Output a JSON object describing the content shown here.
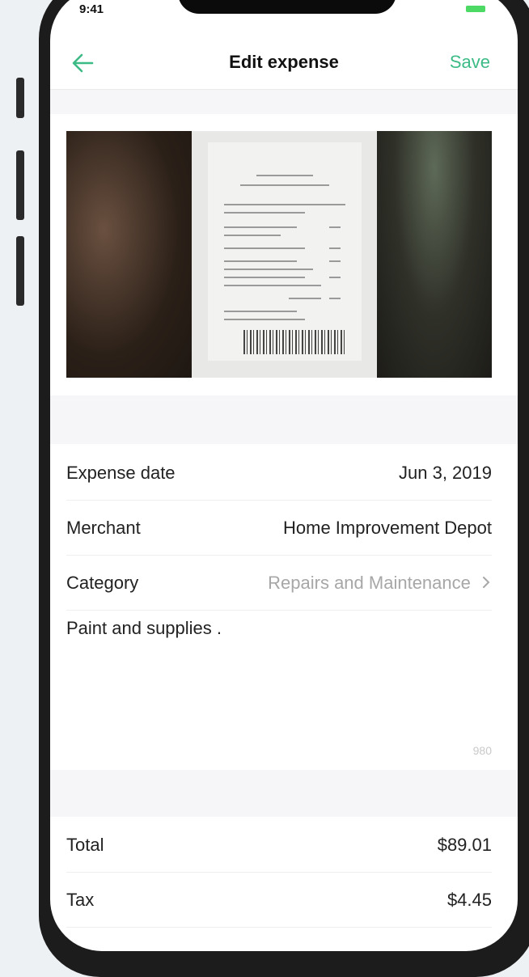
{
  "status": {
    "time": "9:41"
  },
  "nav": {
    "title": "Edit expense",
    "save_label": "Save"
  },
  "fields": [
    {
      "label": "Expense date",
      "value": "Jun 3, 2019"
    },
    {
      "label": "Merchant",
      "value": "Home Improvement Depot"
    },
    {
      "label": "Category",
      "value": "Repairs and Maintenance"
    }
  ],
  "notes": {
    "text": "Paint and supplies .",
    "counter": "980"
  },
  "totals": [
    {
      "label": "Total",
      "value": "$89.01"
    },
    {
      "label": "Tax",
      "value": "$4.45"
    }
  ],
  "colors": {
    "accent": "#3dbb86",
    "battery": "#4cd964"
  },
  "icons": {
    "back": "arrow-left-icon",
    "category_chevron": "chevron-right-icon"
  }
}
